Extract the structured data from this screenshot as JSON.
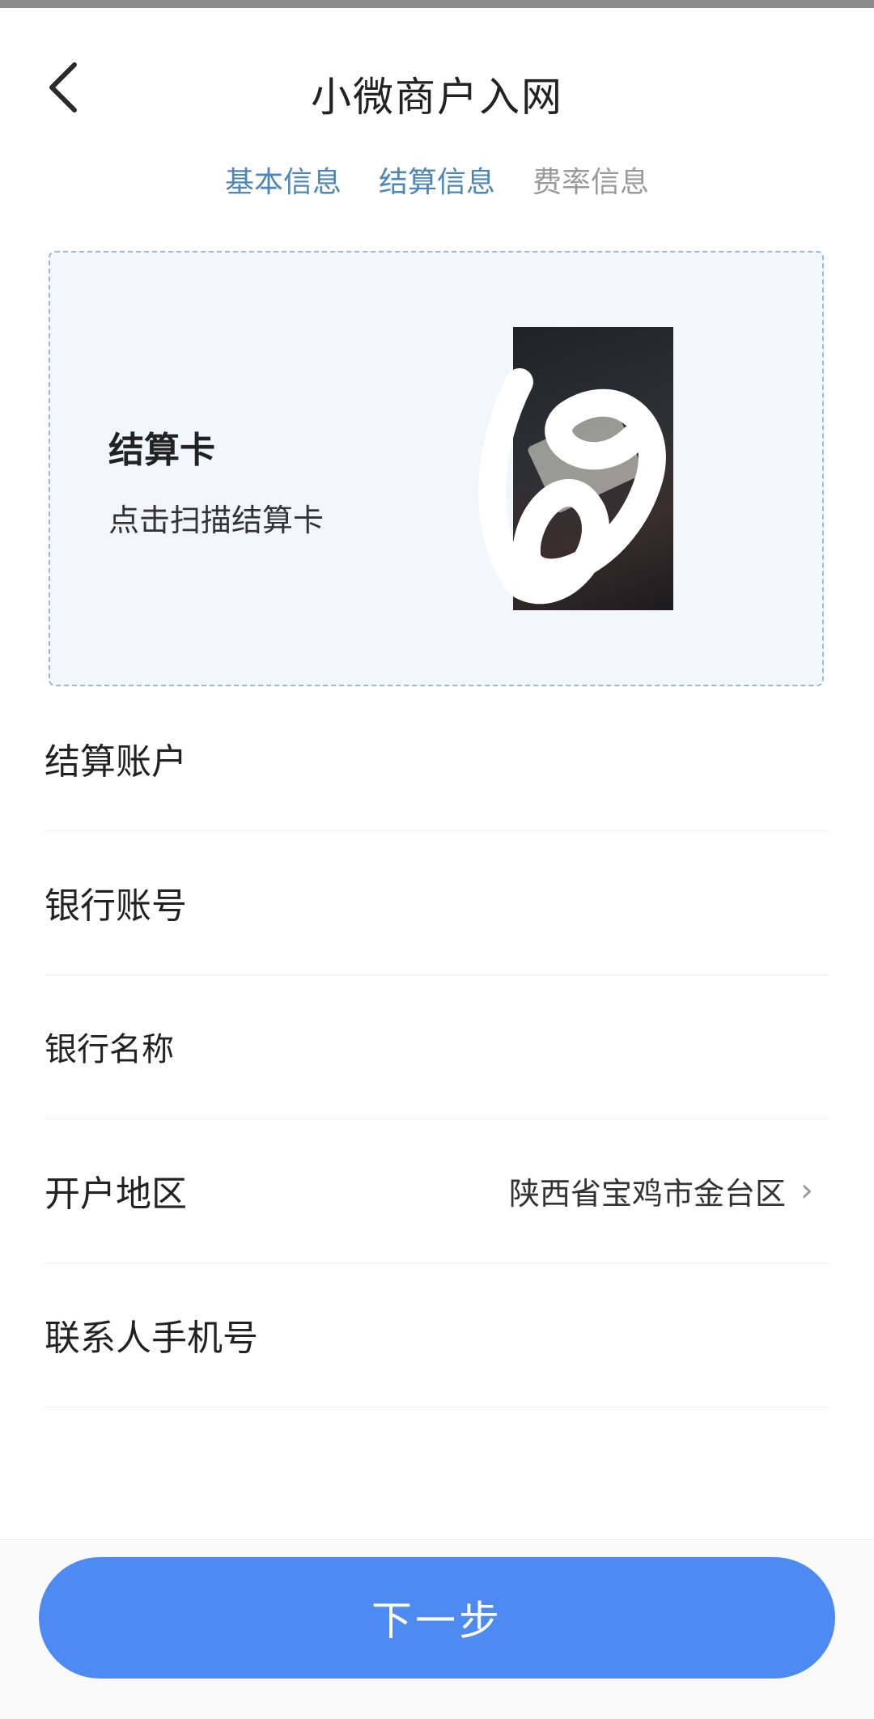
{
  "header": {
    "title": "小微商户入网",
    "back_icon": "chevron-left-icon"
  },
  "steps": [
    {
      "label": "基本信息",
      "state": "active"
    },
    {
      "label": "结算信息",
      "state": "active"
    },
    {
      "label": "费率信息",
      "state": "inactive"
    }
  ],
  "settlement_card": {
    "title": "结算卡",
    "hint": "点击扫描结算卡"
  },
  "form": {
    "rows": [
      {
        "label": "结算账户",
        "value": ""
      },
      {
        "label": "银行账号",
        "value": ""
      },
      {
        "label": "银行名称",
        "value": ""
      },
      {
        "label": "开户地区",
        "value": "陕西省宝鸡市金台区"
      },
      {
        "label": "联系人手机号",
        "value": ""
      }
    ]
  },
  "actions": {
    "next_label": "下一步"
  },
  "colors": {
    "primary_button": "#4d8bf2",
    "active_step": "#4e86b6",
    "card_bg": "#f2f6fd"
  }
}
